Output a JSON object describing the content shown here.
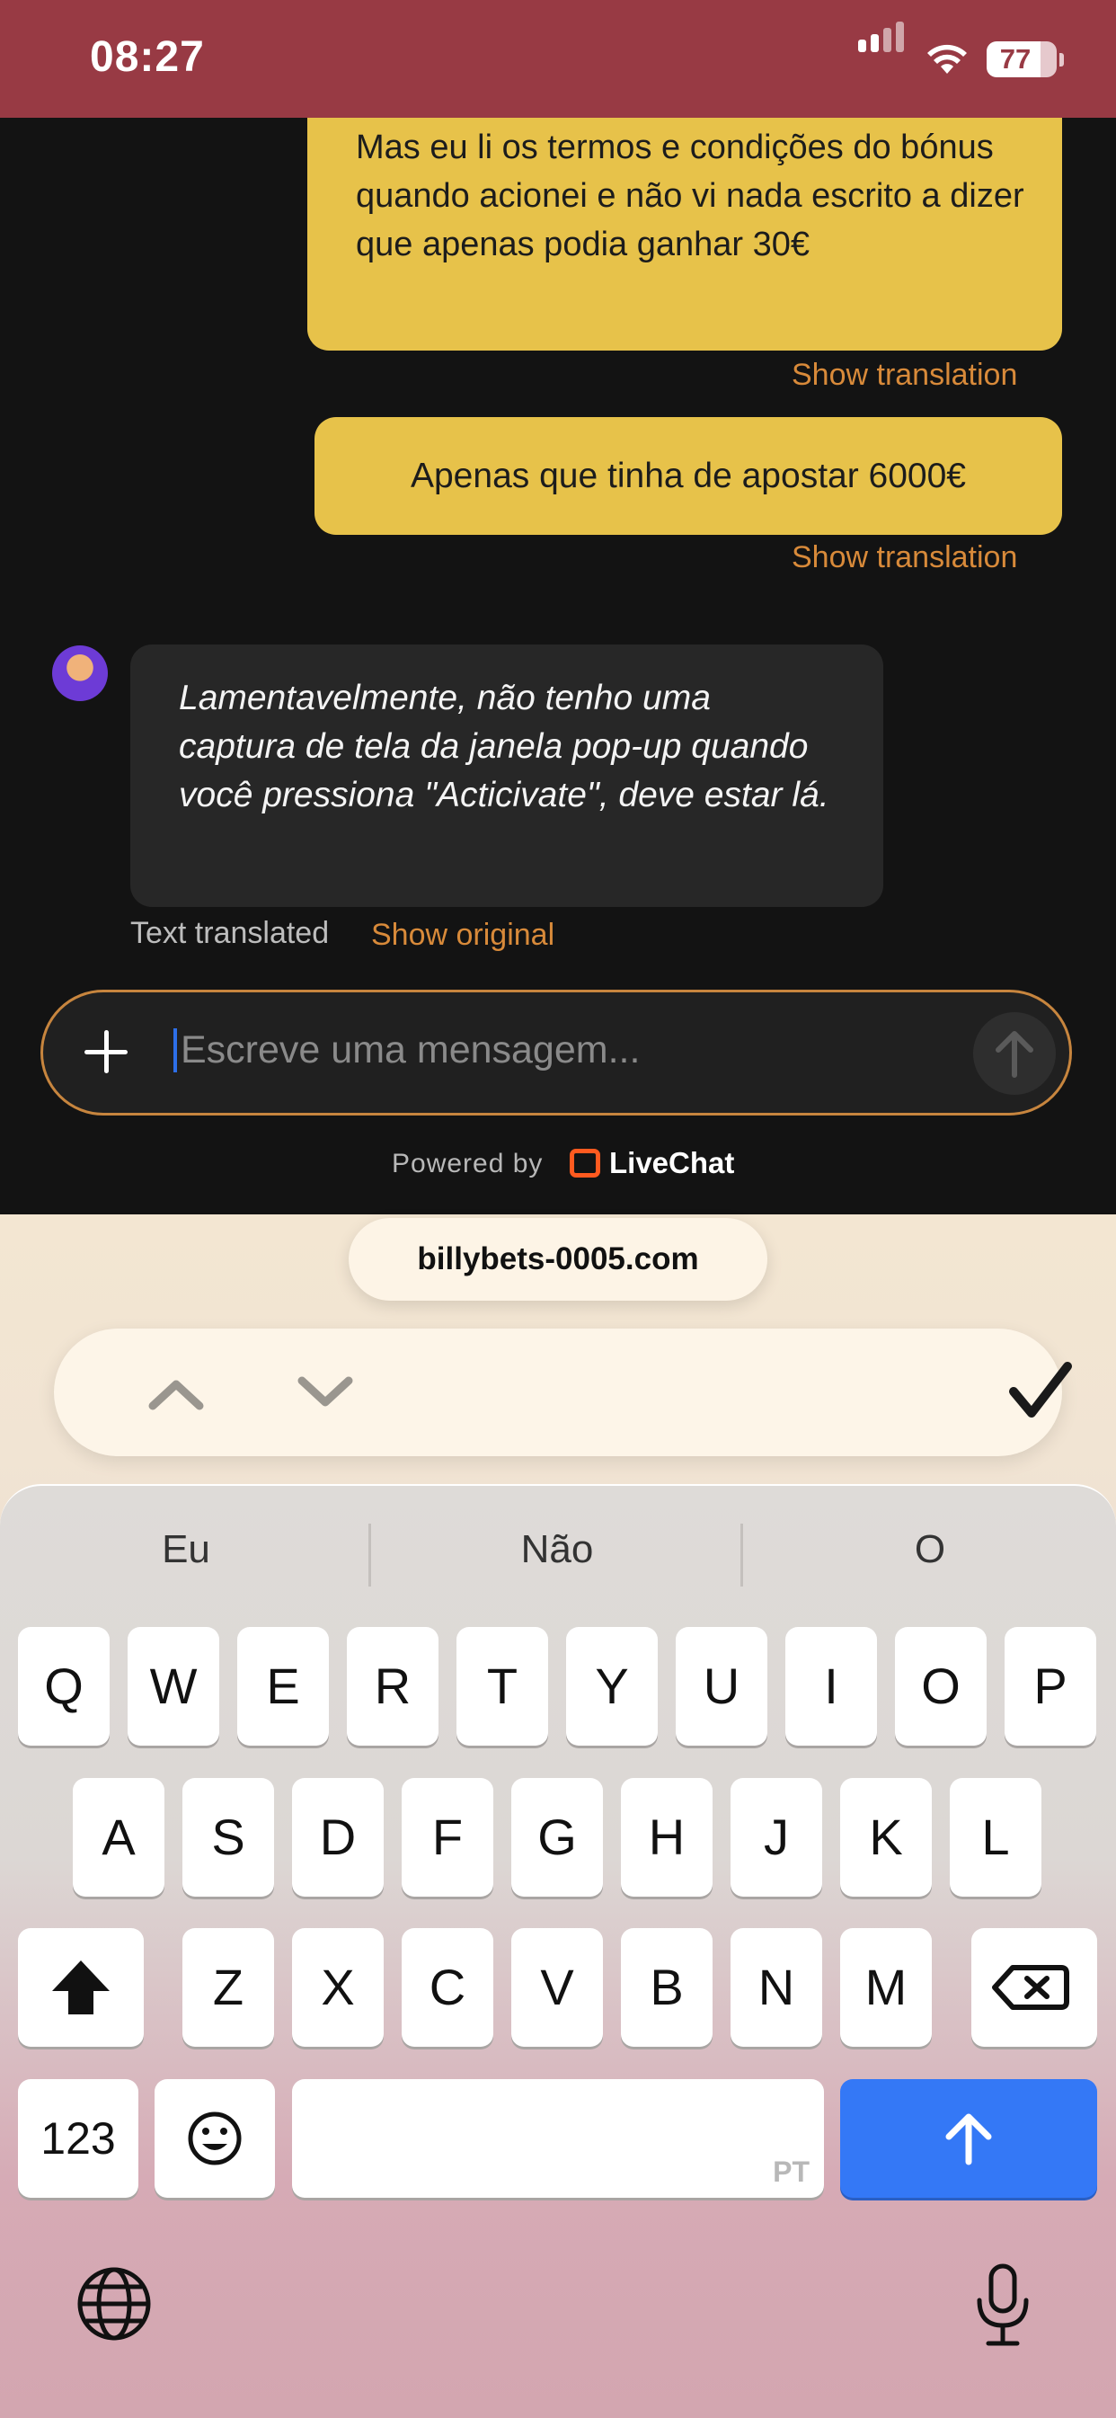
{
  "status_bar": {
    "time": "08:27",
    "battery": "77"
  },
  "chat": {
    "messages": [
      {
        "from": "user",
        "text": "Mas eu li os termos e condições do bónus quando acionei e não vi nada escrito a dizer que apenas podia ganhar 30€",
        "action": "Show translation"
      },
      {
        "from": "user",
        "text": "Apenas que tinha de apostar 6000€",
        "action": "Show translation"
      },
      {
        "from": "agent",
        "text": "Lamentavelmente, não tenho uma captura de tela da janela pop-up quando você pressiona \"Acticivate\", deve estar lá.",
        "note": "Text translated",
        "action": "Show original"
      }
    ],
    "composer": {
      "placeholder": "Escreve uma mensagem..."
    },
    "powered_by": "Powered by",
    "brand": "LiveChat"
  },
  "browser": {
    "url": "billybets-0005.com"
  },
  "keyboard": {
    "suggestions": [
      "Eu",
      "Não",
      "O"
    ],
    "row1": [
      "Q",
      "W",
      "E",
      "R",
      "T",
      "Y",
      "U",
      "I",
      "O",
      "P"
    ],
    "row2": [
      "A",
      "S",
      "D",
      "F",
      "G",
      "H",
      "J",
      "K",
      "L"
    ],
    "row3": [
      "Z",
      "X",
      "C",
      "V",
      "B",
      "N",
      "M"
    ],
    "numbers_key": "123",
    "language": "PT"
  },
  "colors": {
    "status_bar": "#983a44",
    "user_bubble": "#e7c24a",
    "agent_bubble": "#272727",
    "accent_link": "#d88a3a",
    "return_key": "#3478f6"
  }
}
